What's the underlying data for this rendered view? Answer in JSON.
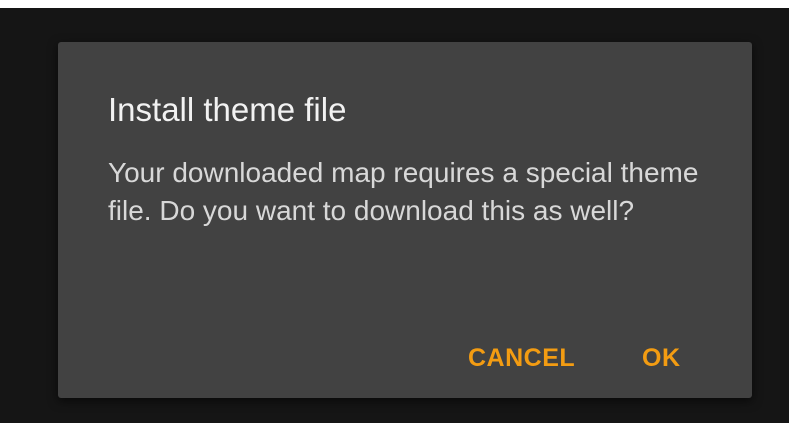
{
  "dialog": {
    "title": "Install theme file",
    "message": "Your downloaded map requires a special theme file. Do you want to download this as well?",
    "cancel_label": "CANCEL",
    "ok_label": "OK",
    "accent_color": "#f39c12",
    "background_color": "#424242"
  }
}
